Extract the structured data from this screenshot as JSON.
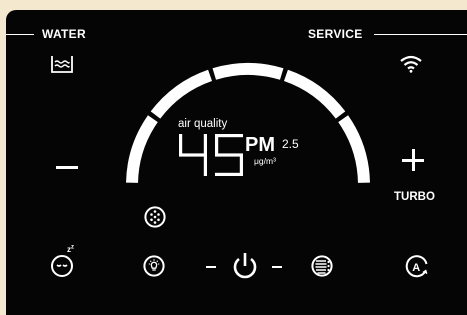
{
  "labels": {
    "water": "WATER",
    "service": "SERVICE",
    "air_quality": "air quality",
    "pm": "PM",
    "pm_sub": "2.5",
    "pm_unit": "μg/m³",
    "turbo": "TURBO"
  },
  "reading": {
    "value": "45"
  },
  "arc": {
    "segments_total": 5,
    "segments_lit": 5
  },
  "icons": {
    "water": "water-tank-icon",
    "wifi": "wifi-icon",
    "minus": "minus-icon",
    "plus": "plus-icon",
    "humidity": "humidity-drops-icon",
    "sleep": "sleep-mode-icon",
    "light": "light-bulb-icon",
    "power": "power-icon",
    "filter": "filter-icon",
    "auto": "auto-mode-icon"
  },
  "colors": {
    "background": "#050505",
    "foreground": "#ffffff",
    "frame": "#f4e8cf"
  }
}
